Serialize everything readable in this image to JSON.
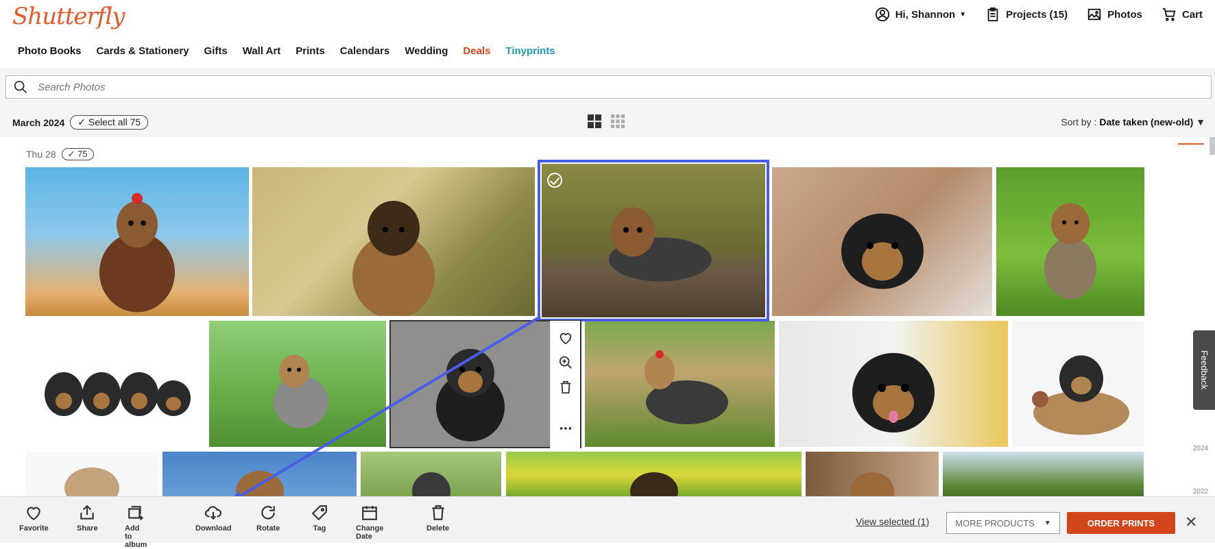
{
  "header": {
    "logo": "Shutterfly",
    "user": "Hi, Shannon",
    "projects": "Projects (15)",
    "photos": "Photos",
    "cart": "Cart"
  },
  "nav": [
    "Photo Books",
    "Cards & Stationery",
    "Gifts",
    "Wall Art",
    "Prints",
    "Calendars",
    "Wedding",
    "Deals",
    "Tinyprints"
  ],
  "search": {
    "placeholder": "Search Photos"
  },
  "month_bar": {
    "month": "March 2024",
    "select_all": "Select all 75"
  },
  "sort": {
    "label": "Sort by : ",
    "value": "Date taken (new-old)"
  },
  "day": {
    "label": "Thu 28",
    "count": "75"
  },
  "timeline": {
    "years": [
      "2024",
      "2022"
    ]
  },
  "feedback": "Feedback",
  "actions": [
    {
      "icon": "heart-icon",
      "label": "Favorite"
    },
    {
      "icon": "share-icon",
      "label": "Share"
    },
    {
      "icon": "add-album-icon",
      "label": "Add to album"
    },
    {
      "icon": "download-icon",
      "label": "Download"
    },
    {
      "icon": "rotate-icon",
      "label": "Rotate"
    },
    {
      "icon": "tag-icon",
      "label": "Tag"
    },
    {
      "icon": "calendar-icon",
      "label": "Change Date"
    },
    {
      "icon": "trash-icon",
      "label": "Delete"
    }
  ],
  "bottom": {
    "view_selected": "View selected (1)",
    "more_products": "MORE PRODUCTS",
    "order_prints": "ORDER PRINTS"
  },
  "colors": {
    "brand": "#e35a2b",
    "order_button": "#d2461b",
    "tinyprints": "#1d9cb1",
    "selection": "#4a5de8"
  }
}
